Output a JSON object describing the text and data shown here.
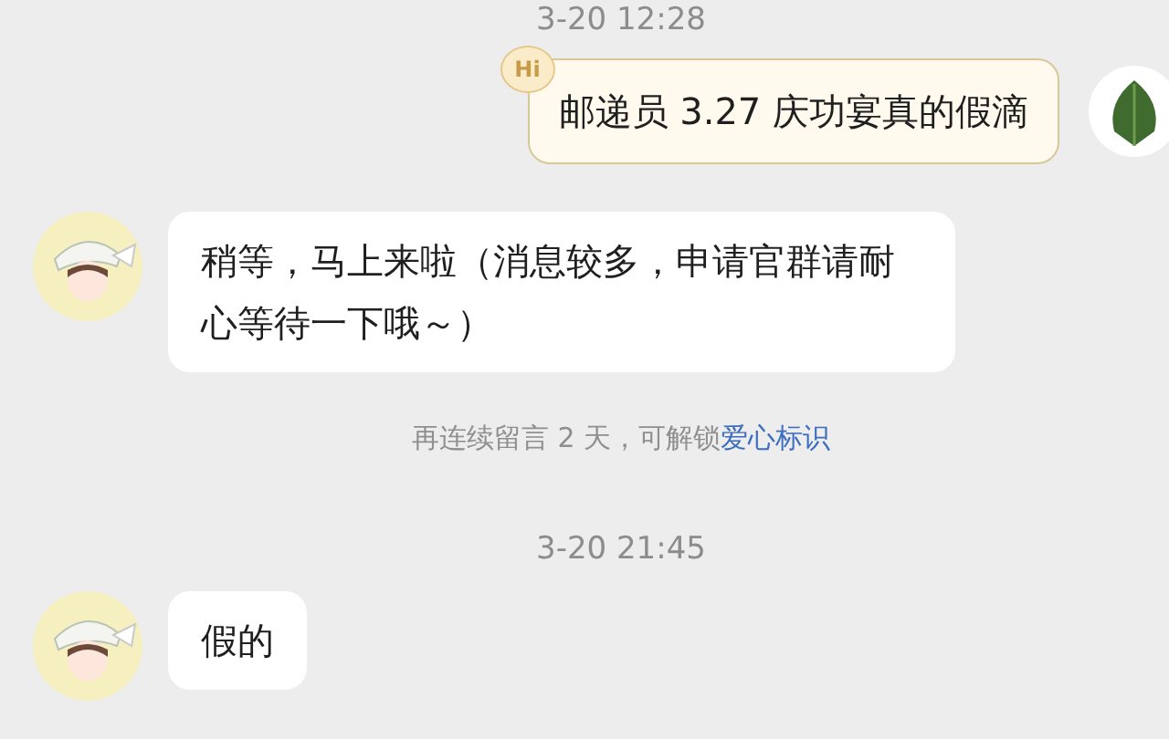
{
  "messages": [
    {
      "kind": "timestamp",
      "text": "3-20 12:28"
    },
    {
      "kind": "outgoing",
      "badge": "Hi",
      "text": "邮递员 3.27 庆功宴真的假滴"
    },
    {
      "kind": "incoming",
      "text": "稍等，马上来啦（消息较多，申请官群请耐心等待一下哦～）"
    },
    {
      "kind": "notice",
      "text": "再连续留言 2 天，可解锁",
      "link": "爱心标识"
    },
    {
      "kind": "timestamp",
      "text": "3-20 21:45"
    },
    {
      "kind": "incoming",
      "text": "假的"
    }
  ]
}
